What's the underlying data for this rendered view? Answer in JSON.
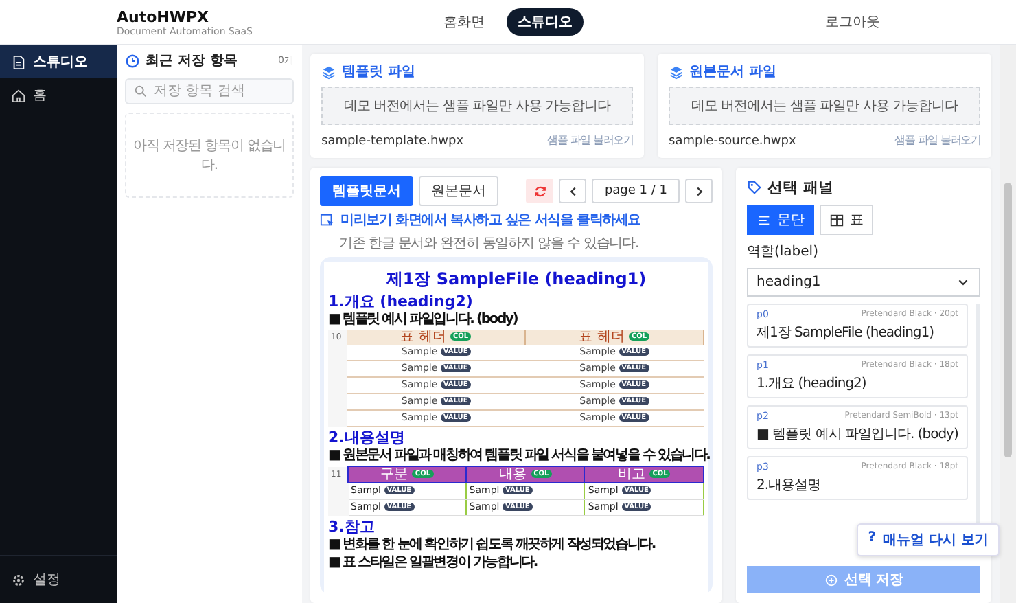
{
  "header": {
    "brand": "AutoHWPX",
    "tagline": "Document Automation SaaS",
    "nav": [
      {
        "label": "홈화면",
        "selected": false
      },
      {
        "label": "스튜디오",
        "selected": true
      }
    ],
    "logout": "로그아웃"
  },
  "sidebar": {
    "items": [
      {
        "label": "스튜디오",
        "selected": true
      },
      {
        "label": "홈",
        "selected": false
      }
    ],
    "footer": "설정"
  },
  "recent": {
    "title": "최근 저장 항목",
    "count": "0개",
    "search_placeholder": "저장 항목 검색",
    "empty": "아직 저장된 항목이 없습니다."
  },
  "file_cards": [
    {
      "title": "템플릿 파일",
      "dropzone": "데모 버전에서는 샘플 파일만 사용 가능합니다",
      "filename": "sample-template.hwpx",
      "link": "샘플 파일 불러오기"
    },
    {
      "title": "원본문서 파일",
      "dropzone": "데모 버전에서는 샘플 파일만 사용 가능합니다",
      "filename": "sample-source.hwpx",
      "link": "샘플 파일 불러오기"
    }
  ],
  "preview": {
    "tabs": [
      {
        "label": "템플릿문서",
        "selected": true
      },
      {
        "label": "원본문서",
        "selected": false
      }
    ],
    "page": "page 1 / 1",
    "hint": "미리보기 화면에서 복사하고 싶은 서식을 클릭하세요",
    "note": "기존 한글 문서와 완전히 동일하지 않을 수 있습니다.",
    "document": [
      {
        "kind": "heading1",
        "text": "제1장 SampleFile (heading1)"
      },
      {
        "kind": "heading2",
        "text": "1.개요 (heading2)"
      },
      {
        "kind": "body",
        "text": "■ 템플릿 예시 파일입니다. (body)"
      },
      {
        "kind": "table",
        "index": "10",
        "header": [
          {
            "text": "표 헤더",
            "badge": "COL"
          },
          {
            "text": "표 헤더",
            "badge": "COL"
          }
        ],
        "rows": [
          [
            {
              "text": "Sample",
              "badge": "VALUE"
            },
            {
              "text": "Sample",
              "badge": "VALUE"
            }
          ],
          [
            {
              "text": "Sample",
              "badge": "VALUE"
            },
            {
              "text": "Sample",
              "badge": "VALUE"
            }
          ],
          [
            {
              "text": "Sample",
              "badge": "VALUE"
            },
            {
              "text": "Sample",
              "badge": "VALUE"
            }
          ],
          [
            {
              "text": "Sample",
              "badge": "VALUE"
            },
            {
              "text": "Sample",
              "badge": "VALUE"
            }
          ],
          [
            {
              "text": "Sample",
              "badge": "VALUE"
            },
            {
              "text": "Sample",
              "badge": "VALUE"
            }
          ]
        ]
      },
      {
        "kind": "heading2",
        "text": "2.내용설명"
      },
      {
        "kind": "body",
        "text": "■ 원본문서 파일과 매칭하여 템플릿 파일 서식을 붙여넣을 수 있습니다."
      },
      {
        "kind": "colortable",
        "index": "11",
        "header": [
          {
            "text": "구분",
            "badge": "COL"
          },
          {
            "text": "내용",
            "badge": "COL"
          },
          {
            "text": "비고",
            "badge": "COL"
          }
        ],
        "rows": [
          [
            {
              "text": "Sampl",
              "badge": "VALUE"
            },
            {
              "text": "Sampl",
              "badge": "VALUE"
            },
            {
              "text": "Sampl",
              "badge": "VALUE"
            }
          ],
          [
            {
              "text": "Sampl",
              "badge": "VALUE"
            },
            {
              "text": "Sampl",
              "badge": "VALUE"
            },
            {
              "text": "Sampl",
              "badge": "VALUE"
            }
          ]
        ]
      },
      {
        "kind": "heading2",
        "text": "3.참고"
      },
      {
        "kind": "body",
        "text": "■ 변화를 한 눈에 확인하기 쉽도록 깨끗하게 작성되었습니다."
      },
      {
        "kind": "body",
        "text": "■ 표 스타일은 일괄변경이 가능합니다."
      }
    ]
  },
  "panel": {
    "title": "선택 패널",
    "modes": [
      {
        "label": "문단",
        "selected": true
      },
      {
        "label": "표",
        "selected": false
      }
    ],
    "role_label": "역할(label)",
    "role_value": "heading1",
    "items": [
      {
        "id": "p0",
        "font": "Pretendard Black · 20pt",
        "text": "제1장 SampleFile (heading1)"
      },
      {
        "id": "p1",
        "font": "Pretendard Black · 18pt",
        "text": "1.개요 (heading2)"
      },
      {
        "id": "p2",
        "font": "Pretendard SemiBold · 13pt",
        "text": "■ 템플릿 예시 파일입니다. (body)"
      },
      {
        "id": "p3",
        "font": "Pretendard Black · 18pt",
        "text": "2.내용설명"
      }
    ],
    "save": "선택 저장"
  },
  "help": {
    "icon": "?",
    "label": "매뉴얼 다시 보기"
  }
}
